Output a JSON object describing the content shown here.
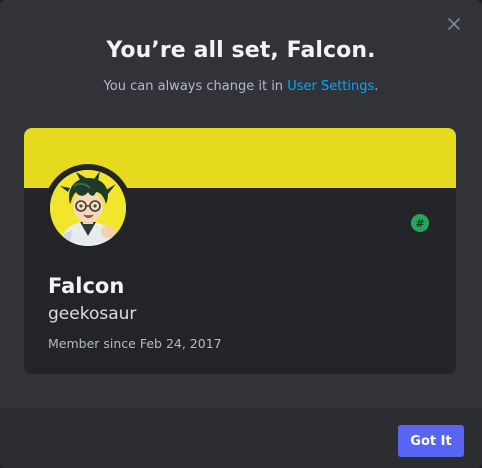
{
  "dialog": {
    "title": "You’re all set, Falcon.",
    "subtitle_prefix": "You can always change it in ",
    "settings_link": "User Settings",
    "subtitle_suffix": "."
  },
  "profile": {
    "display_name": "Falcon",
    "username": "geekosaur",
    "member_since": "Member since Feb 24, 2017",
    "badge_symbol": "#",
    "banner_color": "#e6da1e",
    "badge_color": "#23a55a"
  },
  "footer": {
    "confirm_label": "Got It"
  },
  "icons": {
    "close": "close-icon",
    "avatar": "anime-character-avatar",
    "badge": "hashtag-icon"
  },
  "colors": {
    "accent": "#5865f2",
    "link": "#00a8fc",
    "modal_bg": "#313338",
    "card_bg": "#232428"
  }
}
